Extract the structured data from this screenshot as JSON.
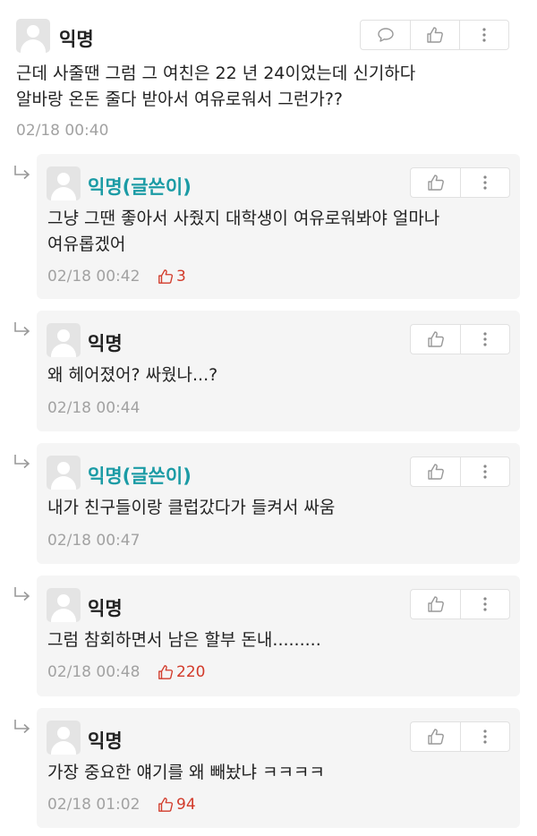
{
  "post": {
    "author": "익명",
    "lines": [
      "근데 사줄땐 그럼 그 여친은 22 년 24이었는데 신기하다",
      "알바랑 온돈 줄다 받아서 여유로워서 그런가??"
    ],
    "time": "02/18 00:40"
  },
  "replies": [
    {
      "author": "익명(글쓴이)",
      "is_op": true,
      "lines": [
        "그냥 그땐 좋아서 사줬지 대학생이 여유로워봐야 얼마나",
        "여유롭겠어"
      ],
      "time": "02/18 00:42",
      "votes": "3"
    },
    {
      "author": "익명",
      "is_op": false,
      "lines": [
        "왜 헤어졌어? 싸웠나...?"
      ],
      "time": "02/18 00:44",
      "votes": ""
    },
    {
      "author": "익명(글쓴이)",
      "is_op": true,
      "lines": [
        "내가 친구들이랑 클럽갔다가 들켜서 싸움"
      ],
      "time": "02/18 00:47",
      "votes": ""
    },
    {
      "author": "익명",
      "is_op": false,
      "lines": [
        "그럼 참회하면서 남은 할부 돈내........."
      ],
      "time": "02/18 00:48",
      "votes": "220"
    },
    {
      "author": "익명",
      "is_op": false,
      "lines": [
        "가장 중요한 얘기를 왜 빼놨냐 ㅋㅋㅋㅋ"
      ],
      "time": "02/18 01:02",
      "votes": "94"
    }
  ],
  "icons": {
    "comment": "comment-icon",
    "like": "thumbs-up-icon",
    "more": "more-vertical-icon",
    "reply_arrow": "reply-arrow-icon"
  },
  "colors": {
    "op_name": "#1b9ba5",
    "vote": "#d23a2a",
    "timestamp": "#a2a2a2",
    "reply_background": "#f5f5f5"
  }
}
